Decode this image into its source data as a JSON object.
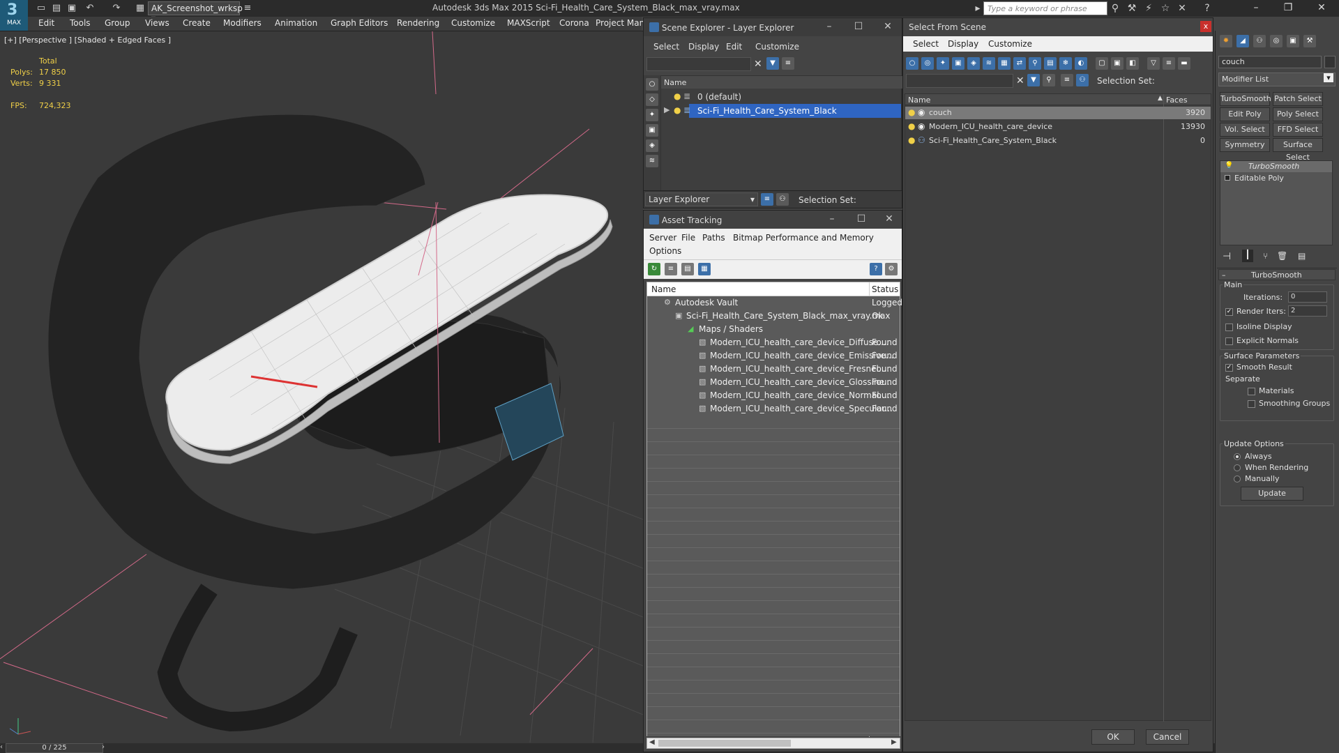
{
  "app": {
    "logo": "MAX",
    "workspace": "AK_Screenshot_wrksp",
    "title": "Autodesk 3ds Max  2015     Sci-Fi_Health_Care_System_Black_max_vray.max",
    "search_placeholder": "Type a keyword or phrase"
  },
  "menu": [
    "Edit",
    "Tools",
    "Group",
    "Views",
    "Create",
    "Modifiers",
    "Animation",
    "Graph Editors",
    "Rendering",
    "Customize",
    "MAXScript",
    "Corona",
    "Project Man"
  ],
  "viewport": {
    "label": "[+] [Perspective ] [Shaded + Edged Faces ]",
    "stats": {
      "total_label": "Total",
      "polys_label": "Polys:",
      "polys_value": "17 850",
      "verts_label": "Verts:",
      "verts_value": "9 331",
      "fps_label": "FPS:",
      "fps_value": "724,323"
    }
  },
  "timeline": {
    "frame": "0 / 225"
  },
  "scene_explorer": {
    "title": "Scene Explorer - Layer Explorer",
    "menu": [
      "Select",
      "Display",
      "Edit",
      "Customize"
    ],
    "column_name": "Name",
    "layers": [
      "0 (default)",
      "Sci-Fi_Health_Care_System_Black"
    ],
    "footer_dropdown": "Layer Explorer",
    "selection_set_label": "Selection Set:"
  },
  "asset_tracking": {
    "title": "Asset Tracking",
    "menu": [
      "Server",
      "File",
      "Paths",
      "Bitmap Performance and Memory"
    ],
    "menu2": [
      "Options"
    ],
    "columns": [
      "Name",
      "Status"
    ],
    "rows": [
      {
        "name": "Autodesk Vault",
        "status": "Logged"
      },
      {
        "name": "Sci-Fi_Health_Care_System_Black_max_vray.max",
        "status": "Ok"
      },
      {
        "name": "Maps / Shaders",
        "status": ""
      },
      {
        "name": "Modern_ICU_health_care_device_Diffuse....",
        "status": "Found"
      },
      {
        "name": "Modern_ICU_health_care_device_Emissive...",
        "status": "Found"
      },
      {
        "name": "Modern_ICU_health_care_device_Fresnel....",
        "status": "Found"
      },
      {
        "name": "Modern_ICU_health_care_device_Glossine...",
        "status": "Found"
      },
      {
        "name": "Modern_ICU_health_care_device_Normal....",
        "status": "Found"
      },
      {
        "name": "Modern_ICU_health_care_device_Specular...",
        "status": "Found"
      }
    ]
  },
  "select_from_scene": {
    "title": "Select From Scene",
    "close": "x",
    "menu": [
      "Select",
      "Display",
      "Customize"
    ],
    "selection_set_label": "Selection Set:",
    "columns": [
      "Name",
      "Faces"
    ],
    "rows": [
      {
        "name": "couch",
        "faces": "3920"
      },
      {
        "name": "Modern_ICU_health_care_device",
        "faces": "13930"
      },
      {
        "name": "Sci-Fi_Health_Care_System_Black",
        "faces": "0"
      }
    ],
    "ok": "OK",
    "cancel": "Cancel"
  },
  "command_panel": {
    "object_name": "couch",
    "modifier_list": "Modifier List",
    "mod_buttons": [
      "TurboSmooth",
      "Patch Select",
      "Edit Poly",
      "Poly Select",
      "Vol. Select",
      "FFD Select",
      "Symmetry",
      "Surface Select"
    ],
    "stack": [
      "TurboSmooth",
      "Editable Poly"
    ],
    "rollout_title": "TurboSmooth",
    "main_label": "Main",
    "iterations_label": "Iterations:",
    "iterations_value": "0",
    "render_iters_label": "Render Iters:",
    "render_iters_value": "2",
    "isoline_label": "Isoline Display",
    "explicit_normals_label": "Explicit Normals",
    "surface_params_label": "Surface Parameters",
    "smooth_result_label": "Smooth Result",
    "separate_label": "Separate",
    "materials_label": "Materials",
    "smoothing_groups_label": "Smoothing Groups",
    "update_options_label": "Update Options",
    "always_label": "Always",
    "when_rendering_label": "When Rendering",
    "manually_label": "Manually",
    "update_button": "Update"
  },
  "colors": {
    "selection_blue": "#2f65c2",
    "accent_teal": "#1e5a78",
    "stat_yellow": "#f0d048"
  }
}
